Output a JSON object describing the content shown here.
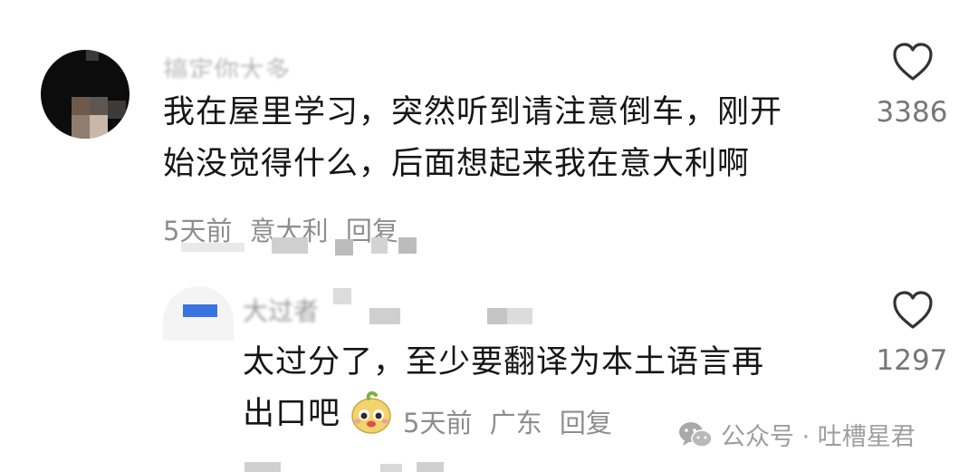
{
  "comments": [
    {
      "username_blurred": "搞定你大多",
      "lines": [
        "我在屋里学习，突然听到请注意倒车，刚开",
        "始没觉得什么，后面想起来我在意大利啊"
      ],
      "time": "5天前",
      "location": "意大利",
      "reply_label": "回复",
      "like_count": "3386",
      "like_icon": "heart-outline-icon"
    },
    {
      "username_blurred": "大过者",
      "lines": [
        "太过分了，至少要翻译为本土语言再",
        "出口吧"
      ],
      "emoji": "cute-face-emoji",
      "time": "5天前",
      "location": "广东",
      "reply_label": "回复",
      "like_count": "1297",
      "like_icon": "heart-outline-icon"
    }
  ],
  "watermark": {
    "icon": "wechat-icon",
    "text": "公众号 · 吐槽星君"
  },
  "colors": {
    "text_primary": "#161616",
    "text_meta": "#8d8d8d",
    "count": "#777777",
    "accent_bar": "#3a73e0"
  }
}
